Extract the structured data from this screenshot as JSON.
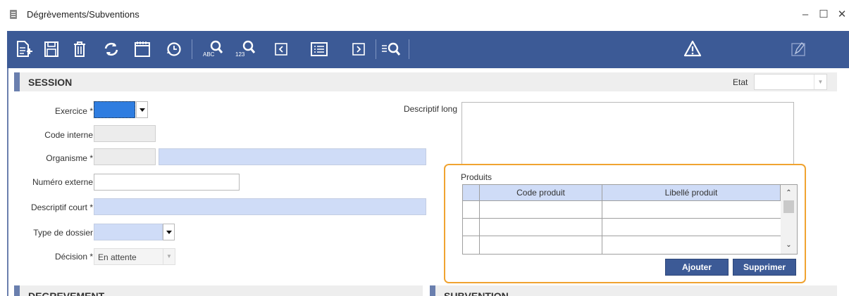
{
  "window": {
    "title": "Dégrèvements/Subventions",
    "controls": {
      "minimize": "–",
      "maximize": "☐",
      "close": "✕"
    }
  },
  "toolbar": {
    "buttons": [
      {
        "name": "new-document-icon"
      },
      {
        "name": "save-icon"
      },
      {
        "name": "delete-icon"
      },
      {
        "name": "refresh-icon"
      },
      {
        "name": "calendar-icon"
      },
      {
        "name": "history-icon"
      },
      {
        "name": "search-text-icon",
        "sub": "ABC"
      },
      {
        "name": "search-number-icon",
        "sub": "123"
      },
      {
        "name": "previous-icon"
      },
      {
        "name": "list-icon"
      },
      {
        "name": "next-icon"
      },
      {
        "name": "filter-search-icon"
      },
      {
        "name": "warning-icon"
      },
      {
        "name": "edit-pen-icon"
      }
    ],
    "accent": "#3c5a96"
  },
  "session": {
    "title": "SESSION",
    "etat_label": "Etat",
    "etat_value": "",
    "exercice_label": "Exercice *",
    "code_interne_label": "Code interne",
    "organisme_label": "Organisme *",
    "numero_externe_label": "Numéro externe",
    "descriptif_court_label": "Descriptif court *",
    "type_dossier_label": "Type de dossier",
    "decision_label": "Décision *",
    "decision_value": "En attente",
    "descriptif_long_label": "Descriptif long"
  },
  "produits": {
    "title": "Produits",
    "columns": [
      "Code produit",
      "Libellé produit"
    ],
    "ajouter_label": "Ajouter",
    "supprimer_label": "Supprimer"
  },
  "sections": {
    "degrevement": "DEGREVEMENT",
    "subvention": "SUBVENTION"
  },
  "colors": {
    "required_field": "#cfdcf7",
    "focus_outline": "#f0a330",
    "section_bar": "#6a7fae"
  }
}
